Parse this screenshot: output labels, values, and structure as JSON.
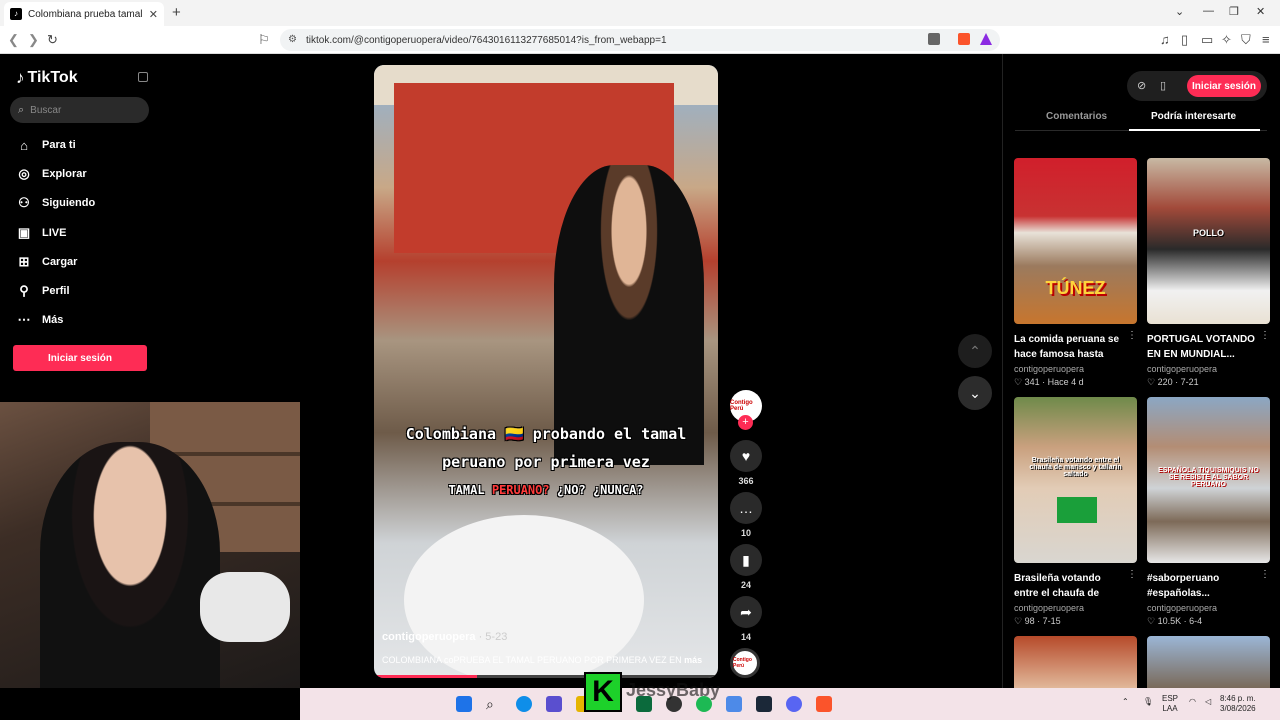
{
  "browser": {
    "tab_title": "Colombiana prueba tamal perua",
    "url": "tiktok.com/@contigoperuopera/video/7643016113277685014?is_from_webapp=1"
  },
  "sidebar": {
    "logo": "TikTok",
    "search_placeholder": "Buscar",
    "items": [
      {
        "label": "Para ti",
        "icon": "home-icon"
      },
      {
        "label": "Explorar",
        "icon": "compass-icon"
      },
      {
        "label": "Siguiendo",
        "icon": "following-icon"
      },
      {
        "label": "LIVE",
        "icon": "live-icon"
      },
      {
        "label": "Cargar",
        "icon": "upload-icon"
      },
      {
        "label": "Perfil",
        "icon": "profile-icon"
      },
      {
        "label": "Más",
        "icon": "more-icon"
      }
    ],
    "login_label": "Iniciar sesión"
  },
  "video": {
    "caption_line1": "Colombiana 🇨🇴 probando el tamal",
    "caption_line2": "peruano por primera vez",
    "caption_line3_a": "TAMAL ",
    "caption_line3_b": "PERUANO?",
    "caption_line3_c": " ¿NO? ¿NUNCA?",
    "author": "contigoperuopera",
    "date": " · 5-23",
    "description": "COLOMBIANA coPRUEBA EL TAMAL PERUANO POR PRIMERA VEZ EN",
    "more": "más",
    "progress": 0.3
  },
  "actions": {
    "avatar_text": "Contigo Perú",
    "likes": "366",
    "comments": "10",
    "saves": "24",
    "shares": "14"
  },
  "right_panel": {
    "login_label": "Iniciar sesión",
    "tab_comments": "Comentarios",
    "tab_interest": "Podría interesarte",
    "cards": [
      {
        "title": "La comida peruana se hace famosa hasta en...",
        "author": "contigoperuopera",
        "stats": "♡ 341 · Hace 4 d",
        "overlay": "TÚNEZ"
      },
      {
        "title": "PORTUGAL VOTANDO EN EN MUNDIAL...",
        "author": "contigoperuopera",
        "stats": "♡ 220 · 7-21",
        "overlay": "POLLO"
      },
      {
        "title": "Brasileña votando entre el chaufa de marisco ...",
        "author": "contigoperuopera",
        "stats": "♡ 98 · 7-15",
        "overlay": "Brasileña votando entre el chaufa de marisco y tallarín saltado"
      },
      {
        "title": "#saborperuano #españolas...",
        "author": "contigoperuopera",
        "stats": "♡ 10.5K · 6-4",
        "overlay": "ESPAÑOLA TIQUISMIQUIS NO SE RESISTE AL SABOR PERUANO"
      }
    ]
  },
  "overlay": {
    "badge": "K",
    "streamer": "JessyBaby"
  },
  "taskbar": {
    "lang1": "ESP",
    "lang2": "LAA",
    "time": "8:46 p. m.",
    "date": "3/08/2026"
  }
}
